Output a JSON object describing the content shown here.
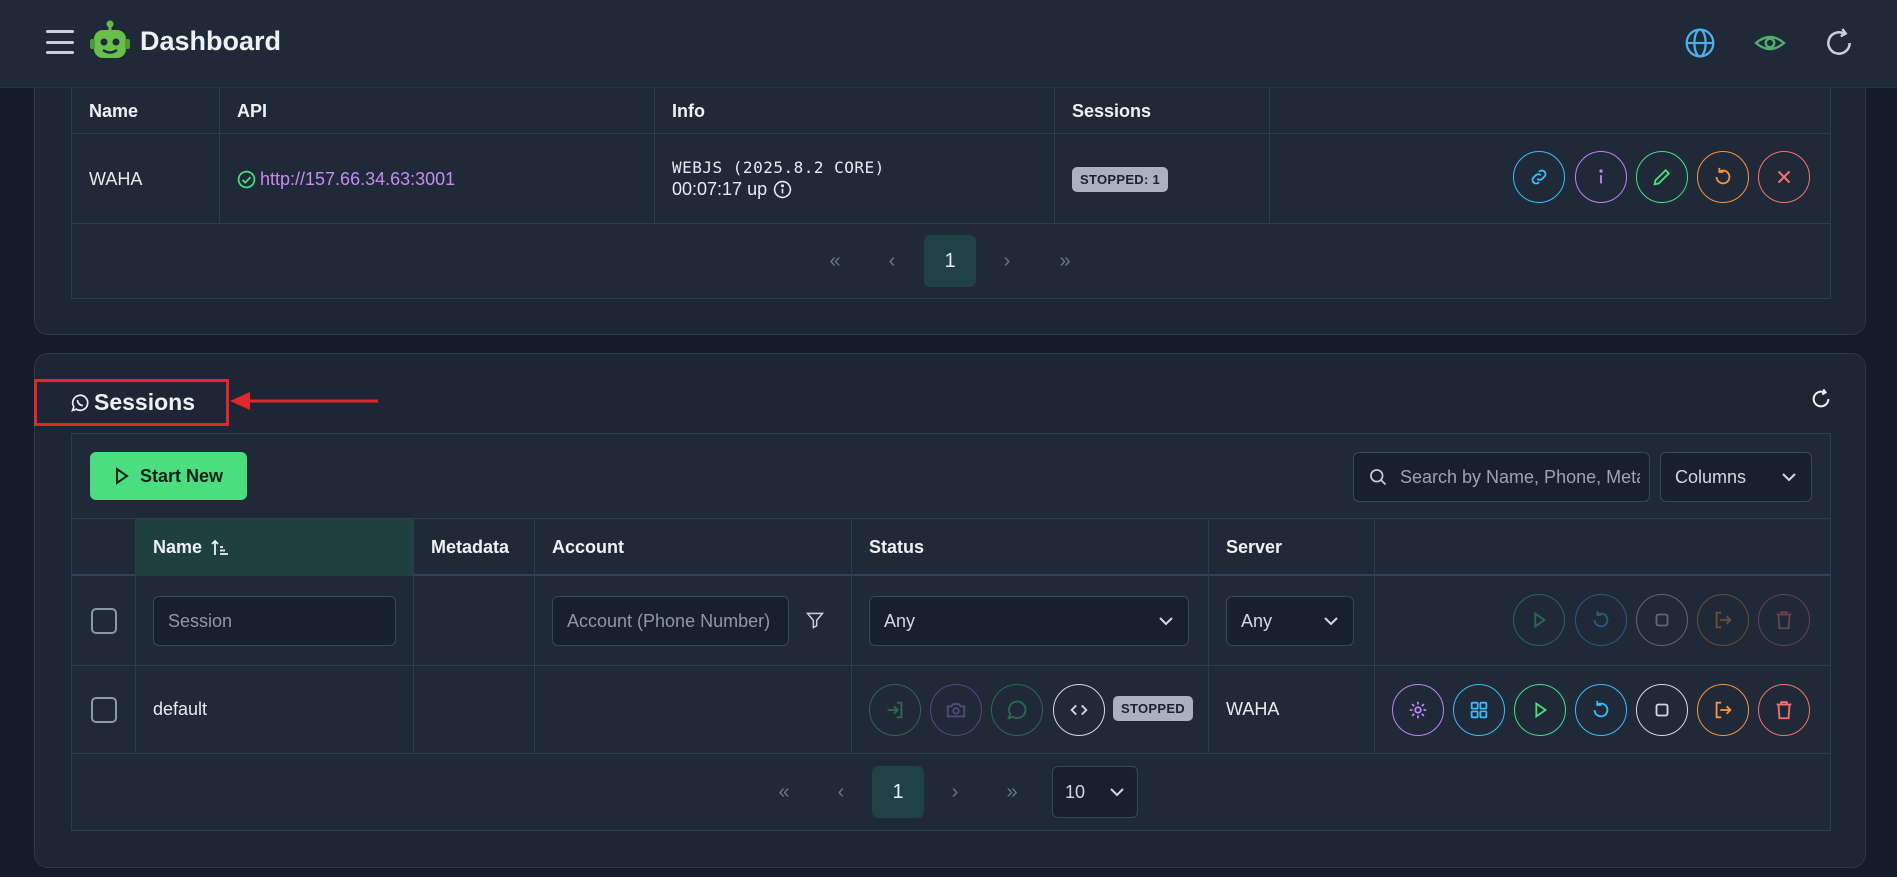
{
  "header": {
    "title": "Dashboard",
    "icons": [
      "menu-icon",
      "robot-logo",
      "globe-icon",
      "eye-icon",
      "refresh-icon"
    ]
  },
  "servers_table": {
    "columns": [
      "Name",
      "API",
      "Info",
      "Sessions",
      ""
    ],
    "rows": [
      {
        "name": "WAHA",
        "api": "http://157.66.34.63:3001",
        "engine": "WEBJS (2025.8.2 CORE)",
        "uptime": "00:07:17 up",
        "sessions_badge": "STOPPED: 1"
      }
    ],
    "pager": {
      "page": "1",
      "first": "«",
      "prev": "‹",
      "next": "›",
      "last": "»"
    }
  },
  "sessions": {
    "title": "Sessions",
    "start_button": "Start New",
    "search_placeholder": "Search by Name, Phone, Metadata",
    "columns_select": "Columns",
    "columns": [
      "Name",
      "Metadata",
      "Account",
      "Status",
      "Server"
    ],
    "filters": {
      "name_placeholder": "Session",
      "account_placeholder": "Account (Phone Number)",
      "status": "Any",
      "server": "Any"
    },
    "rows": [
      {
        "name": "default",
        "status": "STOPPED",
        "server": "WAHA"
      }
    ],
    "pager": {
      "page": "1",
      "first": "«",
      "prev": "‹",
      "next": "›",
      "last": "»",
      "page_size": "10"
    }
  },
  "colors": {
    "accent_green": "#4ade80",
    "accent_blue": "#38bdf8",
    "accent_purple": "#c084fc",
    "accent_orange": "#fb923c",
    "accent_red": "#f87171",
    "annotation_red": "#e0262e"
  }
}
